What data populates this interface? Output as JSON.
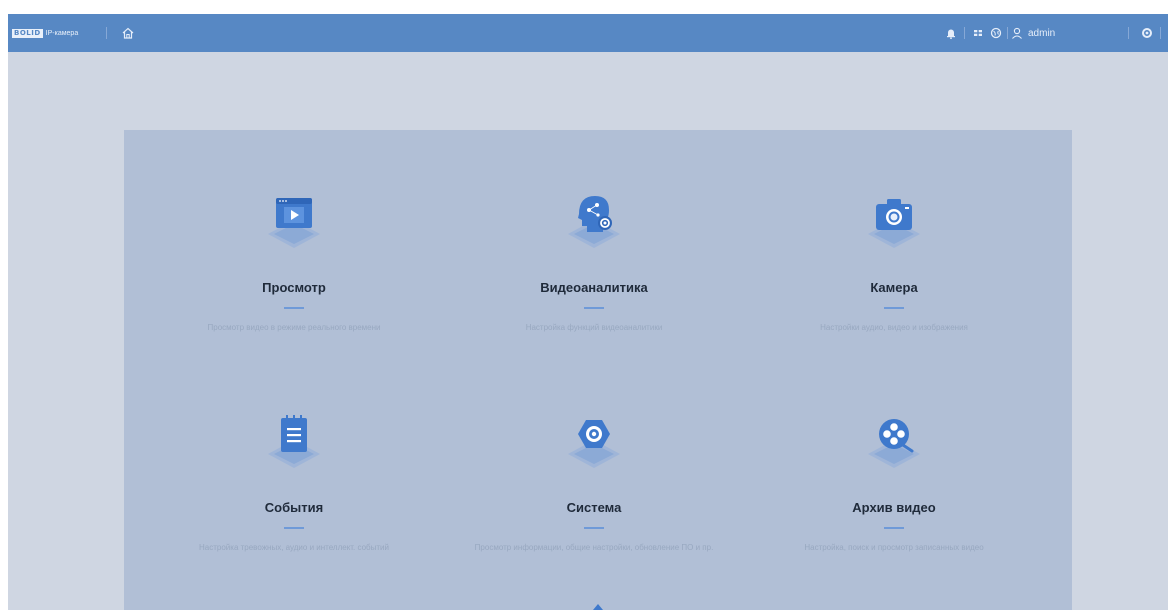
{
  "header": {
    "logo_brand": "BOLID",
    "logo_product": "IP-камера",
    "user_name": "admin"
  },
  "tiles": [
    {
      "title": "Просмотр",
      "description": "Просмотр видео в режиме реального времени",
      "icon": "video-player-icon"
    },
    {
      "title": "Видеоаналитика",
      "description": "Настройка функций видеоаналитики",
      "icon": "ai-head-icon"
    },
    {
      "title": "Камера",
      "description": "Настройки аудио, видео и изображения",
      "icon": "camera-icon"
    },
    {
      "title": "События",
      "description": "Настройка тревожных, аудио и интеллект. событий",
      "icon": "notepad-icon"
    },
    {
      "title": "Система",
      "description": "Просмотр информации, общие настройки, обновление ПО и пр.",
      "icon": "system-gear-icon"
    },
    {
      "title": "Архив видео",
      "description": "Настройка, поиск и просмотр записанных видео",
      "icon": "film-reel-icon"
    }
  ],
  "colors": {
    "header": "#5788c4",
    "background": "#cfd6e2",
    "panel": "#b1bfd6",
    "icon_blue": "#3f79cc",
    "accent_line": "#6f9ad8"
  }
}
